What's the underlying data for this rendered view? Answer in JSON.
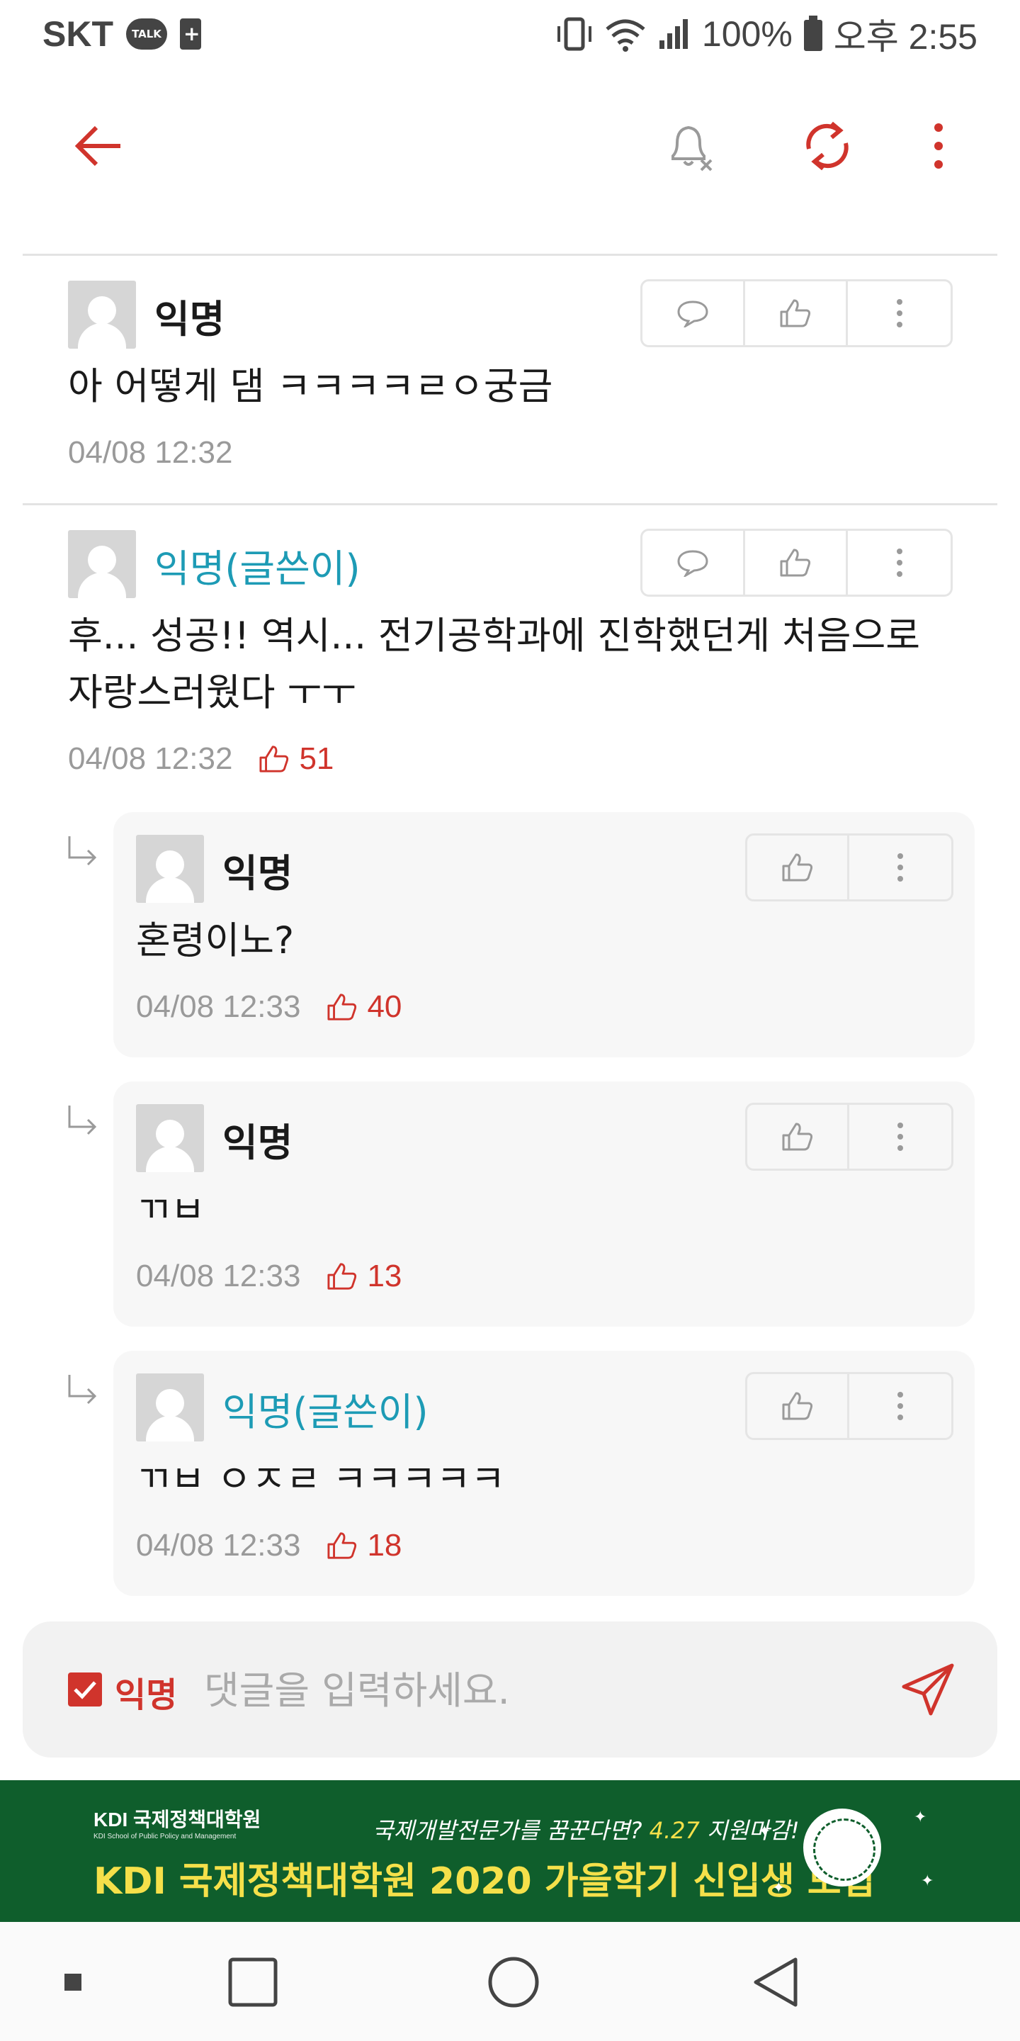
{
  "status_bar": {
    "carrier": "SKT",
    "talk_badge": "TALK",
    "battery": "100%",
    "time": "오후 2:55"
  },
  "appbar": {
    "icons": [
      "back-arrow-icon",
      "bell-off-icon",
      "refresh-icon",
      "more-vertical-icon"
    ],
    "accent_color": "#d0342c"
  },
  "comments": [
    {
      "author": "익명",
      "is_op": false,
      "text": "아 어떻게 댐 ㅋㅋㅋㅋㄹㅇ궁금",
      "time": "04/08 12:32",
      "likes": ""
    },
    {
      "author": "익명(글쓴이)",
      "is_op": true,
      "text_line1": "후... 성공!! 역시... 전기공학과에 진학했던게 처음으로",
      "text_line2": "자랑스러웠다 ㅜㅜ",
      "time": "04/08 12:32",
      "likes": "51"
    }
  ],
  "replies": [
    {
      "author": "익명",
      "is_op": false,
      "text": "혼령이노?",
      "time": "04/08 12:33",
      "likes": "40"
    },
    {
      "author": "익명",
      "is_op": false,
      "text": "ㄲㅂ",
      "time": "04/08 12:33",
      "likes": "13"
    },
    {
      "author": "익명(글쓴이)",
      "is_op": true,
      "text": "ㄲㅂ ㅇㅈㄹ ㅋㅋㅋㅋㅋ",
      "time": "04/08 12:33",
      "likes": "18"
    }
  ],
  "composer": {
    "anon_label": "익명",
    "anon_checked": true,
    "placeholder": "댓글을 입력하세요."
  },
  "ad": {
    "logo_text": "KDI 국제정책대학원",
    "logo_sub": "KDI School of Public Policy and Management",
    "sub_text": "국제개발전문가를 꿈꾼다면?",
    "sub_highlight": "4.27",
    "sub_tail": "지원마감!",
    "headline": "KDI 국제정책대학원 2020 가을학기 신입생 모집",
    "bg_color": "#0f5e2c",
    "accent_color": "#f5e04a"
  },
  "colors": {
    "op_author": "#1d9bb5",
    "like_red": "#d0342c",
    "meta_gray": "#9a9a9a"
  }
}
